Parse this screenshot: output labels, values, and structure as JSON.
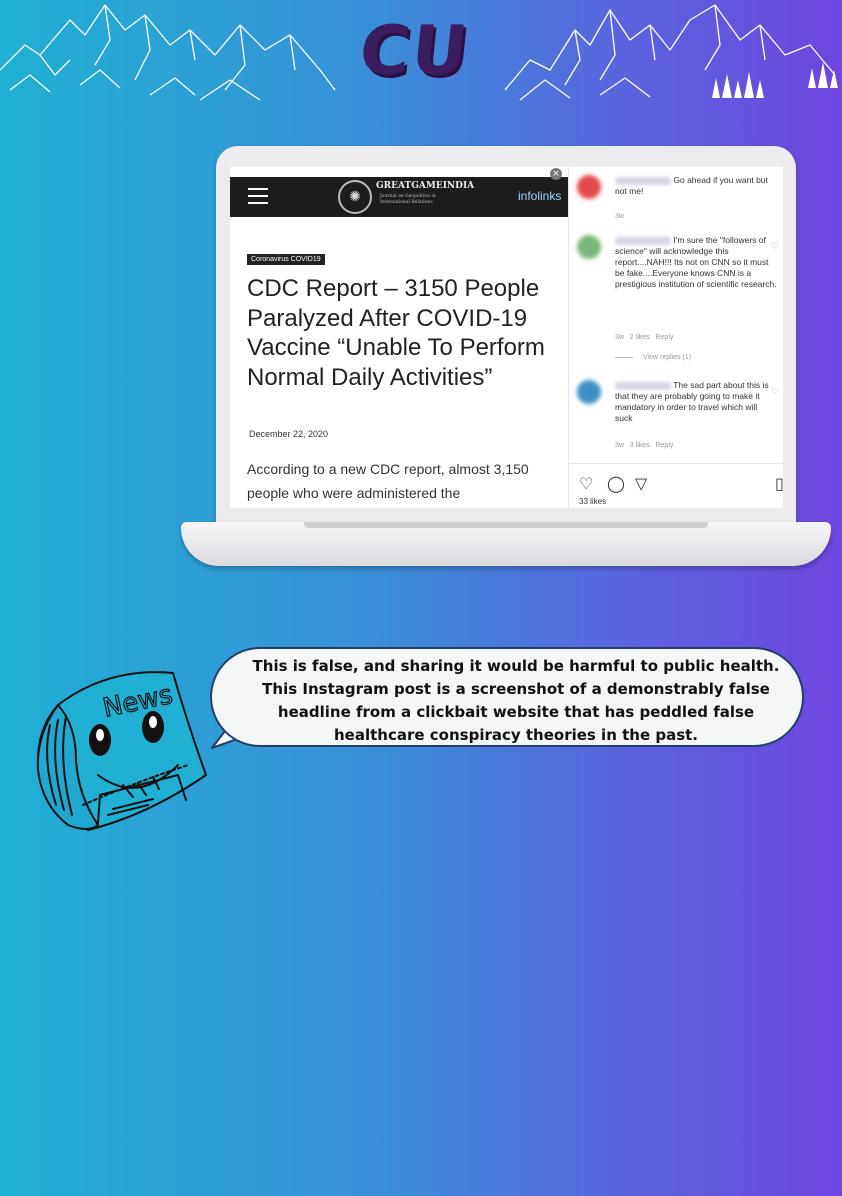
{
  "header": {
    "logo_text": "CU"
  },
  "article": {
    "site_name": "GREATGAMEINDIA",
    "site_subtitle": "Journal on Geopolitics & International Relations",
    "ad_label": "infolinks",
    "category": "Coronavirus COVID19",
    "headline": "CDC Report – 3150 People Paralyzed After COVID-19 Vaccine “Unable To Perform Normal Daily Activities”",
    "date": "December 22, 2020",
    "body": "According to a new CDC report, almost 3,150 people who were administered the"
  },
  "instagram": {
    "comments": [
      {
        "text": "Go ahead if you want but not me!",
        "age": "3w",
        "likes": "",
        "reply": ""
      },
      {
        "text": "I'm sure the \"followers of science\" will acknowledge this report....NAH!!! Its not on CNN so it must be fake....Everyone knows CNN is a prestigious institution of scientific research.",
        "age": "3w",
        "likes": "2 likes",
        "reply": "Reply"
      },
      {
        "text": "The sad part about this is that they are probably going to make it mandatory in order to travel which will suck",
        "age": "3w",
        "likes": "3 likes",
        "reply": "Reply"
      }
    ],
    "view_replies": "View replies (1)",
    "like_count": "33 likes",
    "icons": [
      "heart-icon",
      "comment-icon",
      "share-icon",
      "bookmark-icon"
    ]
  },
  "bubble": {
    "text": "This is false, and sharing it would be harmful to public health. This Instagram post is a screenshot of a demonstrably false headline from a clickbait website that has peddled false healthcare conspiracy theories in the past."
  },
  "mascot": {
    "label": "News"
  },
  "colors": {
    "logo": "#3b1c5e",
    "bubble_border": "#243e6e",
    "gradient_start": "#1fb0d4",
    "gradient_end": "#6e45df"
  }
}
